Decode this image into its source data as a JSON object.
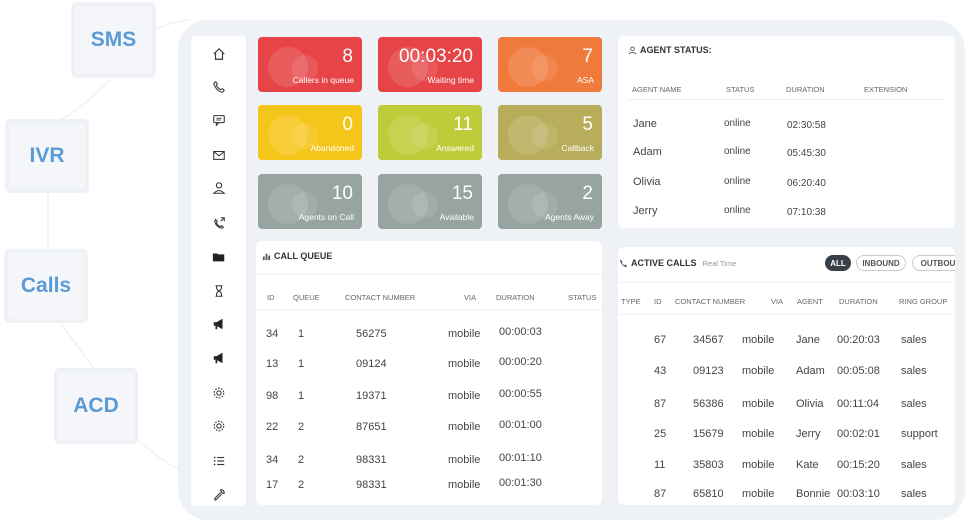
{
  "tags": [
    "SMS",
    "IVR",
    "Calls",
    "ACD"
  ],
  "sidebar": {
    "icons": [
      "home-icon",
      "phone-icon",
      "chat-icon",
      "mail-icon",
      "user-icon",
      "phone-out-icon",
      "folder-icon",
      "hourglass-icon",
      "megaphone-icon",
      "megaphone-icon-2",
      "gear-icon",
      "gear-icon-2",
      "list-icon",
      "wrench-icon"
    ]
  },
  "tiles": [
    {
      "value": "8",
      "label": "Callers in queue",
      "color": "#e64447"
    },
    {
      "value": "00:03:20",
      "label": "Waiting time",
      "color": "#e64447"
    },
    {
      "value": "7",
      "label": "ASA",
      "color": "#f07a3c"
    },
    {
      "value": "0",
      "label": "Abandoned",
      "color": "#f5c61a"
    },
    {
      "value": "11",
      "label": "Answered",
      "color": "#bfcc39"
    },
    {
      "value": "5",
      "label": "Callback",
      "color": "#b8ad5a"
    },
    {
      "value": "10",
      "label": "Agents on Call",
      "color": "#97a49f"
    },
    {
      "value": "15",
      "label": "Available",
      "color": "#97a49f"
    },
    {
      "value": "2",
      "label": "Agents Away",
      "color": "#97a49f"
    }
  ],
  "agent_status": {
    "title": "AGENT STATUS:",
    "headers": [
      "AGENT NAME",
      "STATUS",
      "DURATION",
      "EXTENSION"
    ],
    "rows": [
      {
        "name": "Jane",
        "status": "online",
        "duration": "02:30:58"
      },
      {
        "name": "Adam",
        "status": "online",
        "duration": "05:45:30"
      },
      {
        "name": "Olivia",
        "status": "online",
        "duration": "06:20:40"
      },
      {
        "name": "Jerry",
        "status": "online",
        "duration": "07:10:38"
      }
    ]
  },
  "call_queue": {
    "title": "CALL QUEUE",
    "headers": [
      "ID",
      "QUEUE",
      "CONTACT NUMBER",
      "VIA",
      "DURATION",
      "STATUS"
    ],
    "rows": [
      {
        "id": "34",
        "queue": "1",
        "number": "56275",
        "via": "mobile",
        "duration": "00:00:03"
      },
      {
        "id": "13",
        "queue": "1",
        "number": "09124",
        "via": "mobile",
        "duration": "00:00:20"
      },
      {
        "id": "98",
        "queue": "1",
        "number": "19371",
        "via": "mobile",
        "duration": "00:00:55"
      },
      {
        "id": "22",
        "queue": "2",
        "number": "87651",
        "via": "mobile",
        "duration": "00:01:00"
      },
      {
        "id": "34",
        "queue": "2",
        "number": "98331",
        "via": "mobile",
        "duration": "00:01:10"
      },
      {
        "id": "17",
        "queue": "2",
        "number": "98331",
        "via": "mobile",
        "duration": "00:01:30"
      }
    ]
  },
  "active_calls": {
    "title": "ACTIVE CALLS",
    "subtitle": "Real Time",
    "filters": [
      "ALL",
      "INBOUND",
      "OUTBOU"
    ],
    "headers": [
      "TYPE",
      "ID",
      "CONTACT NUMBER",
      "VIA",
      "AGENT",
      "DURATION",
      "RING GROUP"
    ],
    "rows": [
      {
        "id": "67",
        "number": "34567",
        "via": "mobile",
        "agent": "Jane",
        "duration": "00:20:03",
        "group": "sales"
      },
      {
        "id": "43",
        "number": "09123",
        "via": "mobile",
        "agent": "Adam",
        "duration": "00:05:08",
        "group": "sales"
      },
      {
        "id": "87",
        "number": "56386",
        "via": "mobile",
        "agent": "Olivia",
        "duration": "00:11:04",
        "group": "sales"
      },
      {
        "id": "25",
        "number": "15679",
        "via": "mobile",
        "agent": "Jerry",
        "duration": "00:02:01",
        "group": "support"
      },
      {
        "id": "11",
        "number": "35803",
        "via": "mobile",
        "agent": "Kate",
        "duration": "00:15:20",
        "group": "sales"
      },
      {
        "id": "87",
        "number": "65810",
        "via": "mobile",
        "agent": "Bonnie",
        "duration": "00:03:10",
        "group": "sales"
      }
    ]
  }
}
